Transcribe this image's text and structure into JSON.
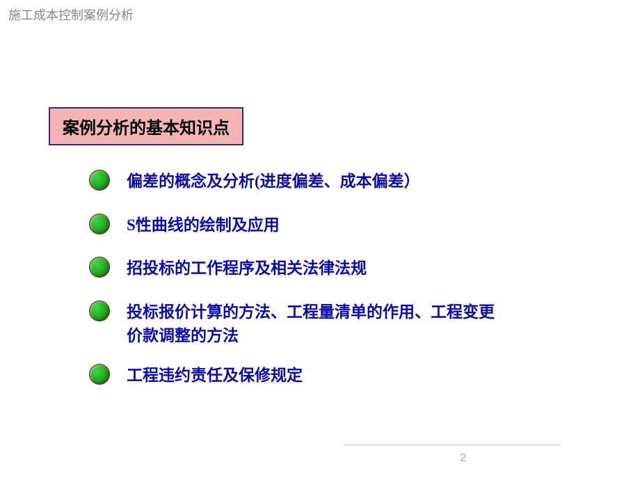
{
  "header": {
    "title": "施工成本控制案例分析"
  },
  "titleBox": {
    "text": "案例分析的基本知识点"
  },
  "items": [
    {
      "text": "偏差的概念及分析(进度偏差、成本偏差）"
    },
    {
      "text": "S性曲线的绘制及应用"
    },
    {
      "text": "招投标的工作程序及相关法律法规"
    },
    {
      "text": "投标报价计算的方法、工程量清单的作用、工程变更价款调整的方法"
    },
    {
      "text": " 工程违约责任及保修规定"
    }
  ],
  "pageNumber": "2"
}
